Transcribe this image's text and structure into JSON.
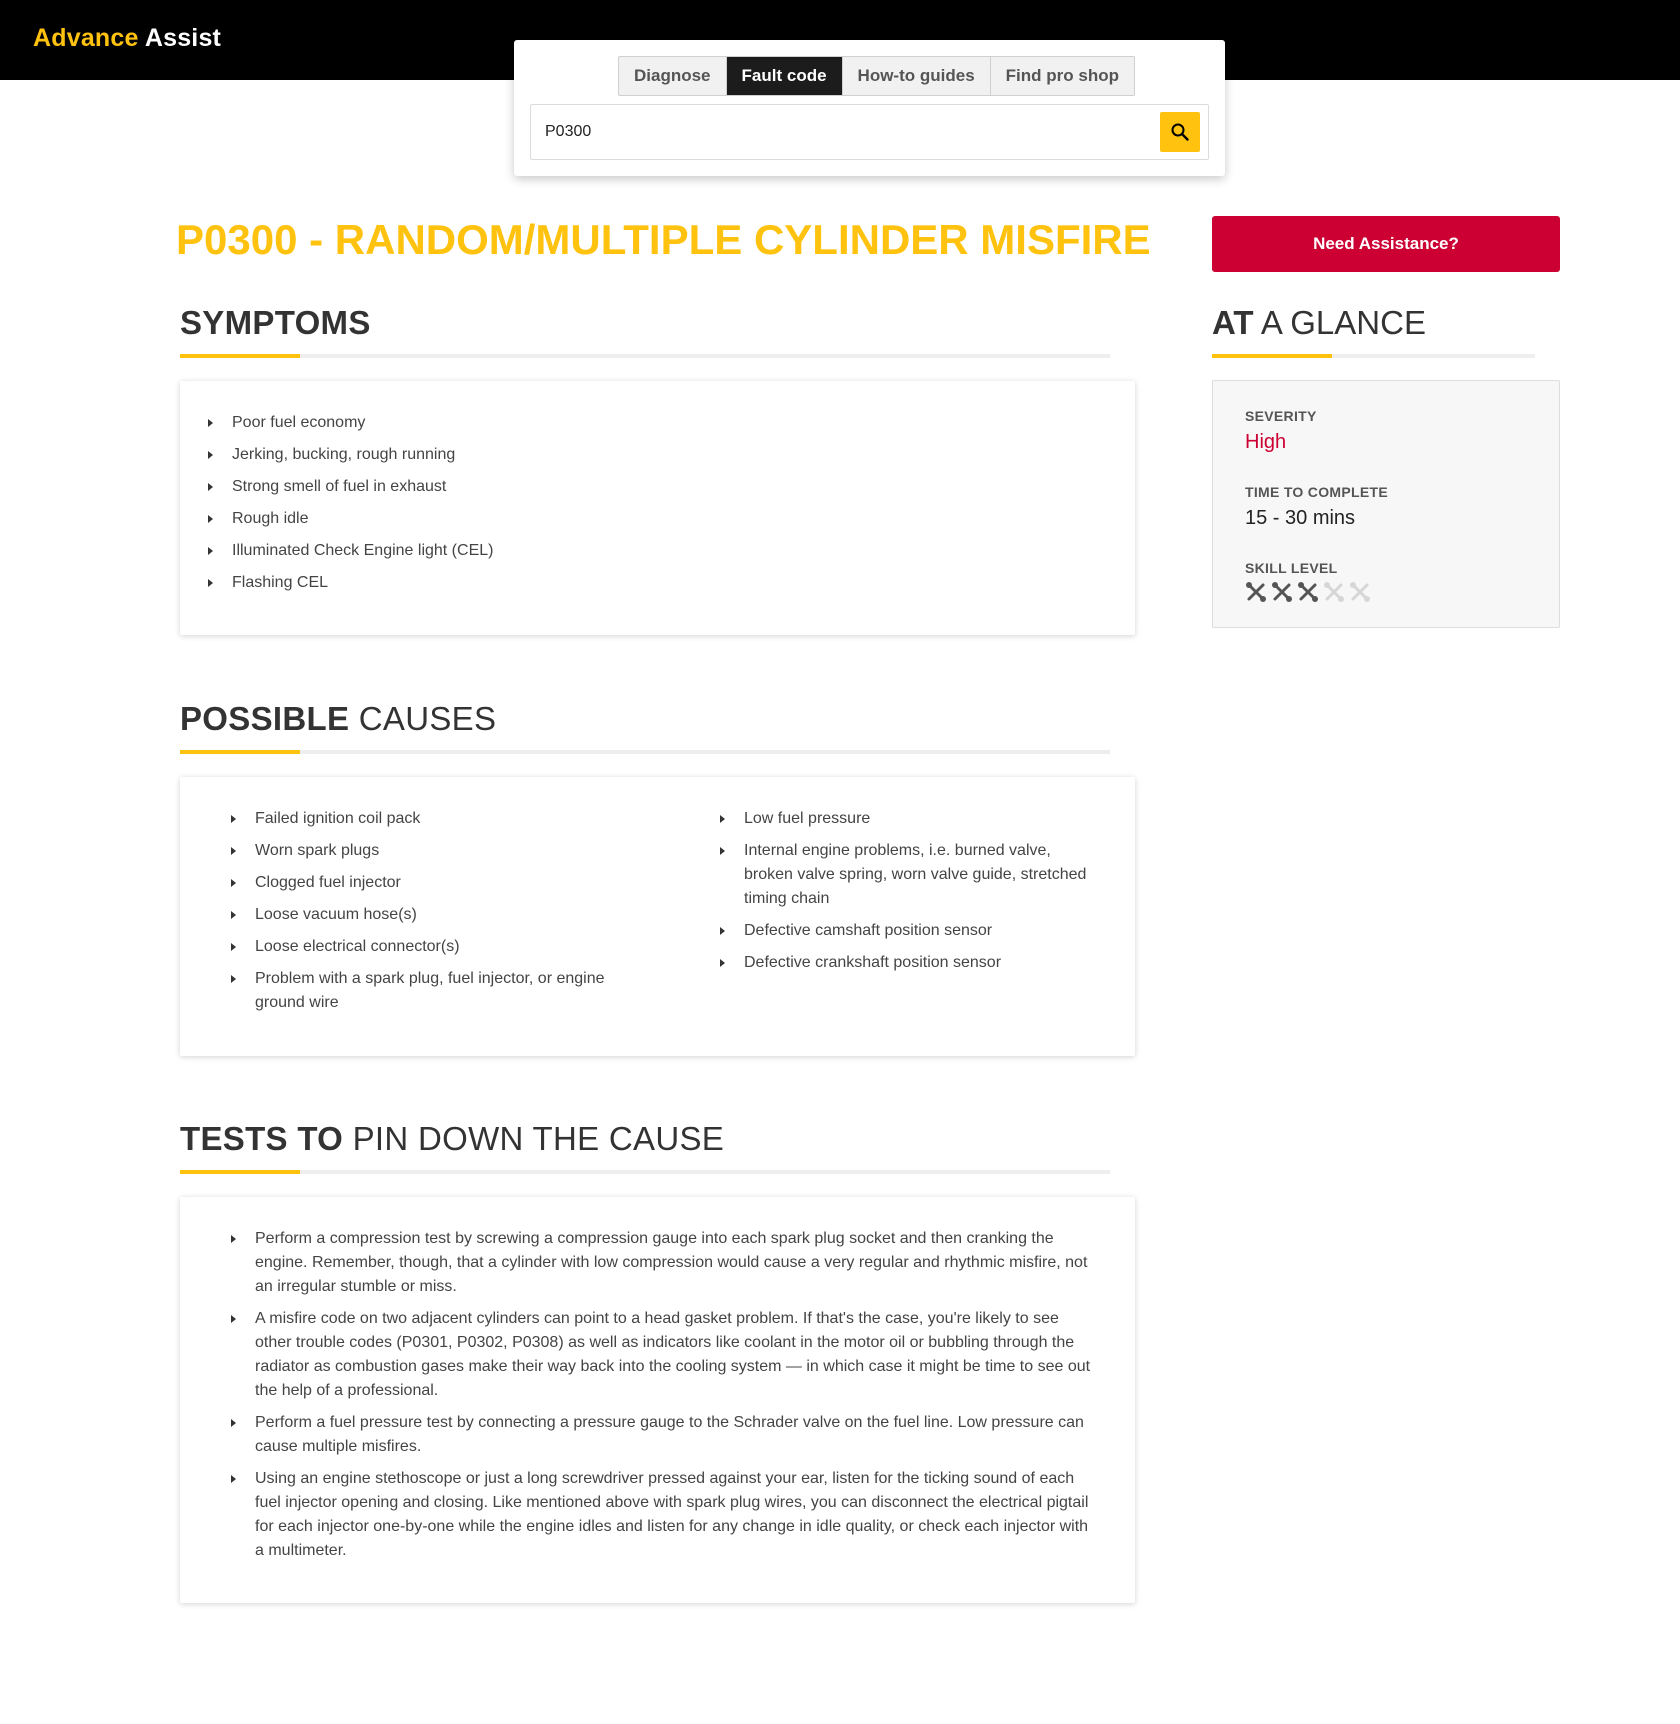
{
  "header": {
    "brand_part1": "Advance",
    "brand_part2": "Assist",
    "brand_color": "#ffc20e",
    "background": "#000000"
  },
  "search_panel": {
    "tabs": [
      {
        "label": "Diagnose",
        "active": false
      },
      {
        "label": "Fault code",
        "active": true
      },
      {
        "label": "How-to guides",
        "active": false
      },
      {
        "label": "Find pro shop",
        "active": false
      }
    ],
    "input_value": "P0300",
    "search_icon": "search-icon"
  },
  "title": {
    "code": "P0300",
    "description": " - RANDOM/MULTIPLE CYLINDER MISFIRE",
    "color": "#ffc20e"
  },
  "symptoms": {
    "heading_strong": "SYMPTOMS",
    "heading_rest": "",
    "items": [
      "Poor fuel economy",
      "Jerking, bucking, rough running",
      "Strong smell of fuel in exhaust",
      "Rough idle",
      "Illuminated Check Engine light (CEL)",
      "Flashing CEL"
    ]
  },
  "causes": {
    "heading_strong": "POSSIBLE",
    "heading_rest": " CAUSES",
    "left_items": [
      "Failed ignition coil pack",
      "Worn spark plugs",
      "Clogged fuel injector",
      "Loose vacuum hose(s)",
      "Loose electrical connector(s)",
      "Problem with a spark plug, fuel injector, or engine ground wire"
    ],
    "right_items": [
      "Low fuel pressure",
      "Internal engine problems, i.e. burned valve, broken valve spring, worn valve guide, stretched timing chain",
      "Defective camshaft position sensor",
      "Defective crankshaft position sensor"
    ]
  },
  "tests": {
    "heading_strong": "TESTS TO",
    "heading_rest": " PIN DOWN THE CAUSE",
    "items": [
      "Perform a compression test by screwing a compression gauge into each spark plug socket and then cranking the engine. Remember, though, that a cylinder with low compression would cause a very regular and rhythmic misfire, not an irregular stumble or miss.",
      "A misfire code on two adjacent cylinders can point to a head gasket problem. If that's the case, you're likely to see other trouble codes (P0301, P0302, P0308) as well as indicators like coolant in the motor oil or bubbling through the radiator as combustion gases make their way back into the cooling system — in which case it might be time to see out the help of a professional.",
      "Perform a fuel pressure test by connecting a pressure gauge to the Schrader valve on the fuel line. Low pressure can cause multiple misfires.",
      "Using an engine stethoscope or just a long screwdriver pressed against your ear, listen for the ticking sound of each fuel injector opening and closing. Like mentioned above with spark plug wires, you can disconnect the electrical pigtail for each injector one-by-one while the engine idles and listen for any change in idle quality, or check each injector with a multimeter."
    ]
  },
  "sidebar": {
    "assist_button": "Need Assistance?",
    "assist_color": "#cc0033",
    "glance_strong": "AT",
    "glance_rest": " A GLANCE",
    "severity_label": "SEVERITY",
    "severity_value": "High",
    "severity_color": "#cc0033",
    "time_label": "TIME TO COMPLETE",
    "time_value": "15 - 30 mins",
    "skill_label": "SKILL LEVEL",
    "skill_level": 3,
    "skill_max": 5,
    "skill_icon": "wrench-screwdriver-icon"
  }
}
